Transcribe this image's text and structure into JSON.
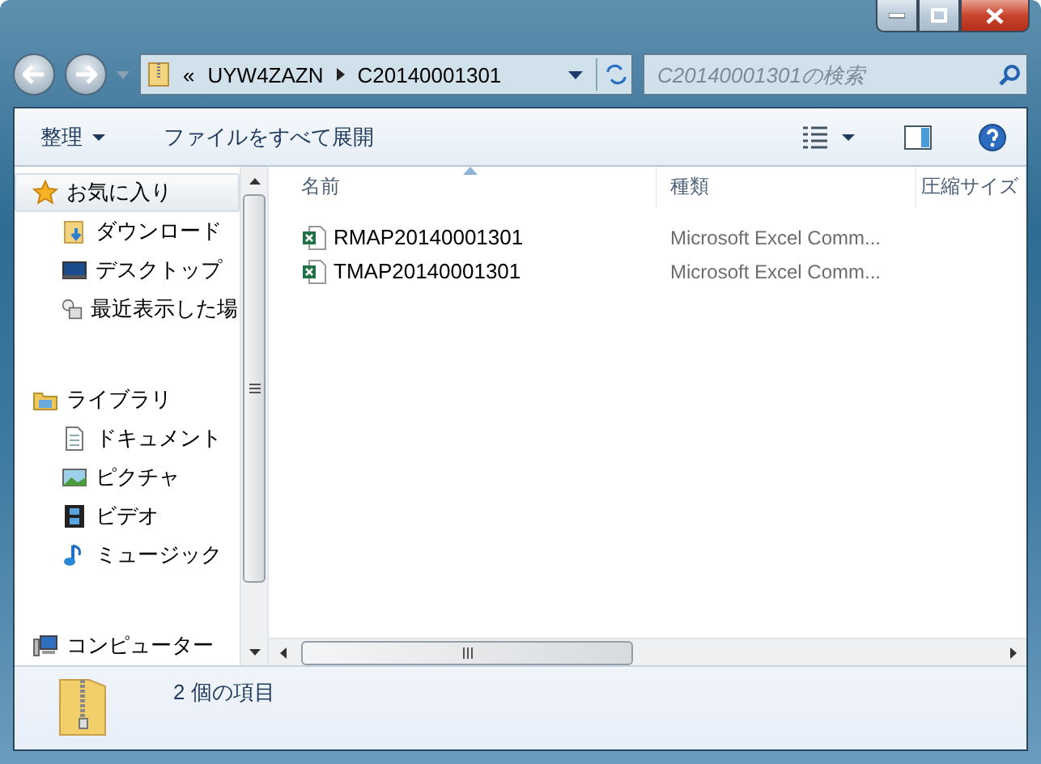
{
  "address_bar": {
    "overflow": "«",
    "path": [
      {
        "label": "UYW4ZAZN"
      },
      {
        "label": "C20140001301"
      }
    ]
  },
  "search": {
    "placeholder": "C20140001301の検索"
  },
  "toolbar": {
    "organize": "整理",
    "extract": "ファイルをすべて展開"
  },
  "nav": [
    {
      "label": "お気に入り",
      "kind": "star",
      "selected": true,
      "children": [
        {
          "label": "ダウンロード",
          "kind": "download",
          "selected": false
        },
        {
          "label": "デスクトップ",
          "kind": "desktop",
          "selected": false
        },
        {
          "label": "最近表示した場",
          "kind": "recent",
          "selected": false
        }
      ]
    },
    {
      "label": "ライブラリ",
      "kind": "library",
      "selected": false,
      "children": [
        {
          "label": "ドキュメント",
          "kind": "document",
          "selected": false
        },
        {
          "label": "ピクチャ",
          "kind": "picture",
          "selected": false
        },
        {
          "label": "ビデオ",
          "kind": "video",
          "selected": false
        },
        {
          "label": "ミュージック",
          "kind": "music",
          "selected": false
        }
      ]
    },
    {
      "label": "コンピューター",
      "kind": "computer",
      "selected": false
    }
  ],
  "table": {
    "columns": [
      "名前",
      "種類",
      "圧縮サイズ"
    ],
    "rows": [
      {
        "name": "RMAP20140001301",
        "type": "Microsoft Excel Comm..."
      },
      {
        "name": "TMAP20140001301",
        "type": "Microsoft Excel Comm..."
      }
    ]
  },
  "status_bar": {
    "text": "2 個の項目"
  }
}
